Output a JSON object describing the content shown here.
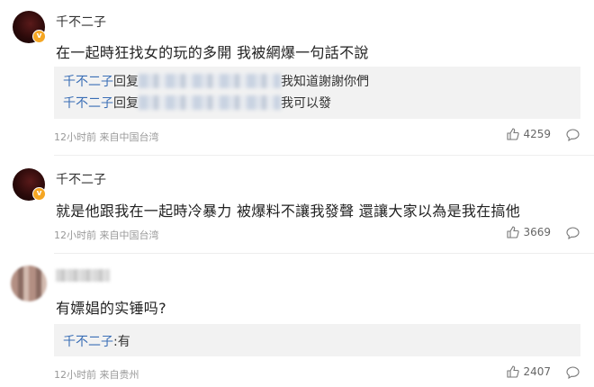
{
  "comments": [
    {
      "username": "千不二子",
      "text": "在一起時狂找女的玩的多開 我被網爆一句話不說",
      "replies": [
        {
          "name": "千不二子",
          "prefix": "回复",
          "text": "我知道謝謝你們"
        },
        {
          "name": "千不二子",
          "prefix": "回复",
          "text": "我可以發"
        }
      ],
      "meta": "12小时前 来自中国台湾",
      "likes": "4259"
    },
    {
      "username": "千不二子",
      "text": "就是他跟我在一起時冷暴力 被爆料不讓我發聲 還讓大家以為是我在搞他",
      "meta": "12小时前 来自中国台湾",
      "likes": "3669"
    },
    {
      "username": "",
      "text": "有嫖娼的实锤吗?",
      "replies": [
        {
          "name": "千不二子",
          "text": ":有"
        }
      ],
      "meta": "12小时前 来自贵州",
      "likes": "2407"
    }
  ],
  "icons": {
    "like": "thumbs-up-icon",
    "comment": "comment-bubble-icon",
    "verified": "verified-badge-icon"
  },
  "colors": {
    "link": "#3b6fb6",
    "badge": "#f5a623",
    "reply_bg": "#f2f2f2",
    "meta": "#999999"
  }
}
